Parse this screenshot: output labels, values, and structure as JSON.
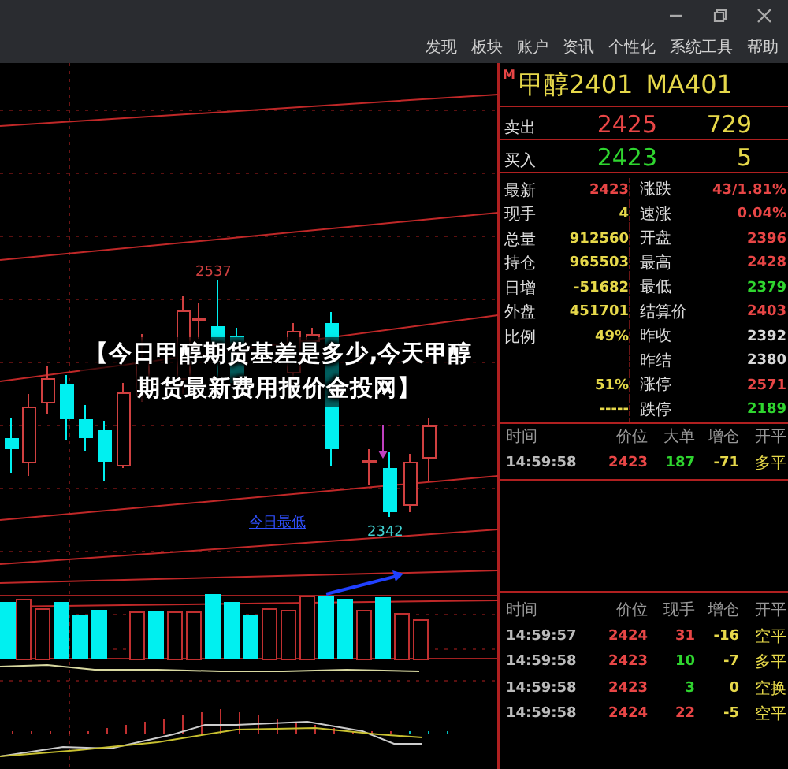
{
  "menu": [
    "发现",
    "板块",
    "账户",
    "资讯",
    "个性化",
    "系统工具",
    "帮助"
  ],
  "chart": {
    "high_label": "2537",
    "low_label": "2342",
    "low_note": "今日最低"
  },
  "quote": {
    "badge": "M",
    "name": "甲醇2401",
    "code": "MA401"
  },
  "book": [
    {
      "label": "卖出",
      "price": "2425",
      "volume": "729",
      "color": "#e84646"
    },
    {
      "label": "买入",
      "price": "2423",
      "volume": "5",
      "color": "#2fd52f"
    }
  ],
  "stats": [
    {
      "left": {
        "label": "最新",
        "value": "2423",
        "color": "#e84646"
      },
      "right": {
        "label": "涨跌",
        "value": "43/1.81%",
        "color": "#e84646"
      }
    },
    {
      "left": {
        "label": "现手",
        "value": "4",
        "color": "#e6d84a"
      },
      "right": {
        "label": "速涨",
        "value": "0.04%",
        "color": "#e84646"
      }
    },
    {
      "left": {
        "label": "总量",
        "value": "912560",
        "color": "#e6d84a"
      },
      "right": {
        "label": "开盘",
        "value": "2396",
        "color": "#e84646"
      }
    },
    {
      "left": {
        "label": "持仓",
        "value": "965503",
        "color": "#e6d84a"
      },
      "right": {
        "label": "最高",
        "value": "2428",
        "color": "#e84646"
      }
    },
    {
      "left": {
        "label": "日增",
        "value": "-51682",
        "color": "#e6d84a"
      },
      "right": {
        "label": "最低",
        "value": "2379",
        "color": "#2fd52f"
      }
    },
    {
      "left": {
        "label": "外盘",
        "value": "451701",
        "color": "#e6d84a"
      },
      "right": {
        "label": "结算价",
        "value": "2403",
        "color": "#e84646"
      }
    },
    {
      "left": {
        "label": "比例",
        "value": "49%",
        "color": "#e6d84a"
      },
      "right": {
        "label": "昨收",
        "value": "2392",
        "color": "#d8d8d8"
      }
    },
    {
      "right": {
        "label": "昨结",
        "value": "2380",
        "color": "#d8d8d8"
      }
    },
    {
      "left": {
        "value": "51%",
        "color": "#e6d84a"
      },
      "right": {
        "label": "涨停",
        "value": "2571",
        "color": "#e84646"
      }
    },
    {
      "left": {
        "value": "-----",
        "color": "#e6d84a"
      },
      "right": {
        "label": "跌停",
        "value": "2189",
        "color": "#2fd52f"
      }
    }
  ],
  "big_trades": {
    "columns": [
      "时间",
      "价位",
      "大单",
      "增仓",
      "开平"
    ],
    "rows": [
      {
        "time": "14:59:58",
        "price": "2423",
        "volume": "187",
        "change": "-71",
        "type": "多平",
        "color": "#2fd52f"
      }
    ]
  },
  "ticks": {
    "columns": [
      "时间",
      "价位",
      "现手",
      "增仓",
      "开平"
    ],
    "rows": [
      {
        "time": "14:59:57",
        "price": "2424",
        "volume": "31",
        "change": "-16",
        "type": "空平",
        "color": "#e84646"
      },
      {
        "time": "14:59:58",
        "price": "2423",
        "volume": "10",
        "change": "-7",
        "type": "多平",
        "color": "#2fd52f"
      },
      {
        "time": "14:59:58",
        "price": "2423",
        "volume": "3",
        "change": "0",
        "type": "空换",
        "color": "#2fd52f"
      },
      {
        "time": "14:59:58",
        "price": "2424",
        "volume": "22",
        "change": "-5",
        "type": "空平",
        "color": "#e84646"
      }
    ]
  },
  "caption": [
    "【今日甲醇期货基差是多少,今天甲醇",
    "期货最新费用报价金投网】"
  ]
}
